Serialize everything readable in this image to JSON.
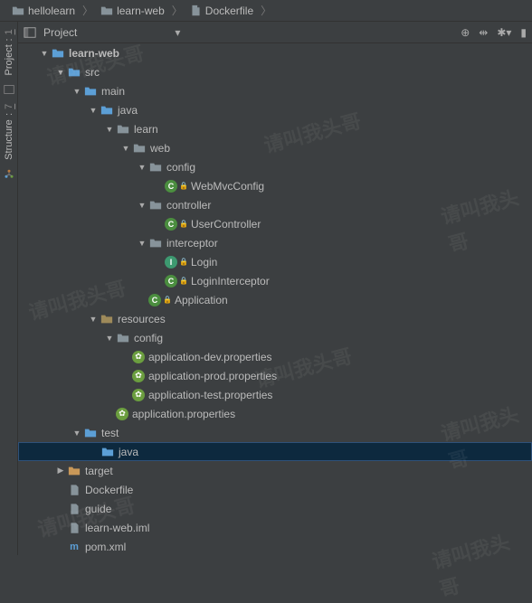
{
  "breadcrumb": [
    {
      "label": "hellolearn",
      "icon": "folder"
    },
    {
      "label": "learn-web",
      "icon": "folder"
    },
    {
      "label": "Dockerfile",
      "icon": "file"
    }
  ],
  "toolbar": {
    "title": "Project"
  },
  "sidebarTabs": [
    {
      "num": "1",
      "label": "Project"
    },
    {
      "num": "7",
      "label": "Structure"
    }
  ],
  "tree": [
    {
      "depth": 0,
      "arrow": "down",
      "icon": "folder-blue",
      "label": "learn-web",
      "bold": true
    },
    {
      "depth": 1,
      "arrow": "down",
      "icon": "folder-blue",
      "label": "src"
    },
    {
      "depth": 2,
      "arrow": "down",
      "icon": "folder-blue",
      "label": "main"
    },
    {
      "depth": 3,
      "arrow": "down",
      "icon": "folder-blue",
      "label": "java"
    },
    {
      "depth": 4,
      "arrow": "down",
      "icon": "folder",
      "label": "learn"
    },
    {
      "depth": 5,
      "arrow": "down",
      "icon": "folder",
      "label": "web"
    },
    {
      "depth": 6,
      "arrow": "down",
      "icon": "folder",
      "label": "config"
    },
    {
      "depth": 7,
      "arrow": "none",
      "icon": "class-c",
      "label": "WebMvcConfig",
      "lock": true
    },
    {
      "depth": 6,
      "arrow": "down",
      "icon": "folder",
      "label": "controller"
    },
    {
      "depth": 7,
      "arrow": "none",
      "icon": "class-c",
      "label": "UserController",
      "lock": true
    },
    {
      "depth": 6,
      "arrow": "down",
      "icon": "folder",
      "label": "interceptor"
    },
    {
      "depth": 7,
      "arrow": "none",
      "icon": "class-i",
      "label": "Login",
      "lock": true
    },
    {
      "depth": 7,
      "arrow": "none",
      "icon": "class-c",
      "label": "LoginInterceptor",
      "lock": true
    },
    {
      "depth": 6,
      "arrow": "none",
      "icon": "class-c",
      "label": "Application",
      "lock": true
    },
    {
      "depth": 3,
      "arrow": "down",
      "icon": "folder-res",
      "label": "resources"
    },
    {
      "depth": 4,
      "arrow": "down",
      "icon": "folder",
      "label": "config"
    },
    {
      "depth": 5,
      "arrow": "none",
      "icon": "prop",
      "label": "application-dev.properties"
    },
    {
      "depth": 5,
      "arrow": "none",
      "icon": "prop",
      "label": "application-prod.properties"
    },
    {
      "depth": 5,
      "arrow": "none",
      "icon": "prop",
      "label": "application-test.properties"
    },
    {
      "depth": 4,
      "arrow": "none",
      "icon": "prop",
      "label": "application.properties"
    },
    {
      "depth": 2,
      "arrow": "down",
      "icon": "folder-blue",
      "label": "test"
    },
    {
      "depth": 3,
      "arrow": "none",
      "icon": "folder-blue",
      "label": "java",
      "selected": true
    },
    {
      "depth": 1,
      "arrow": "right",
      "icon": "folder-orange",
      "label": "target"
    },
    {
      "depth": 1,
      "arrow": "none",
      "icon": "file",
      "label": "Dockerfile"
    },
    {
      "depth": 1,
      "arrow": "none",
      "icon": "file",
      "label": "guide"
    },
    {
      "depth": 1,
      "arrow": "none",
      "icon": "file",
      "label": "learn-web.iml"
    },
    {
      "depth": 1,
      "arrow": "none",
      "icon": "file-m",
      "label": "pom.xml"
    }
  ],
  "watermarks": [
    "请叫我头哥"
  ]
}
